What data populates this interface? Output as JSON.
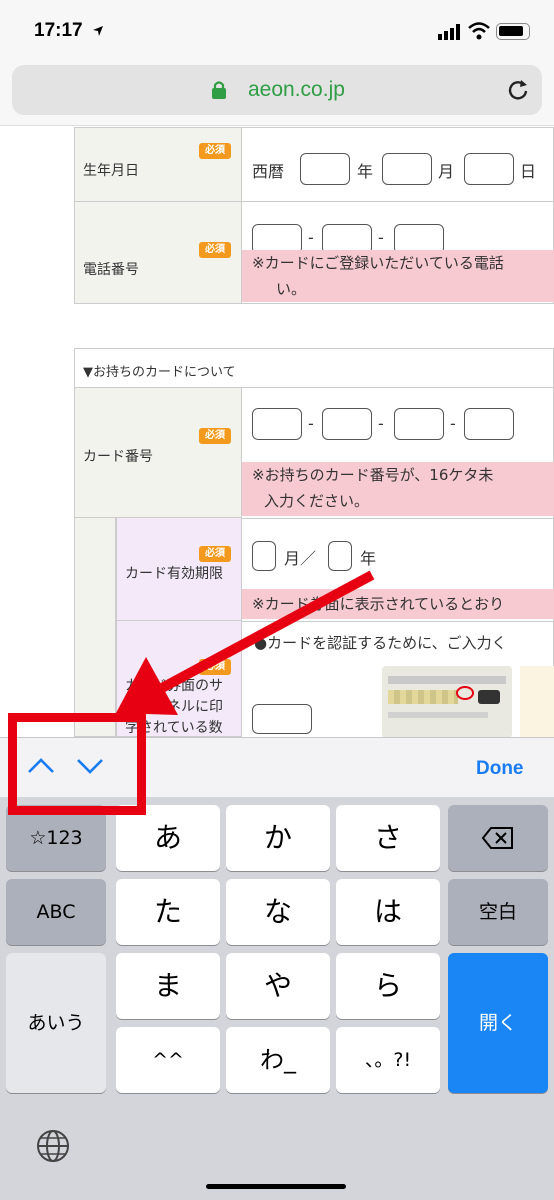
{
  "status": {
    "time": "17:17"
  },
  "browser": {
    "url": "aeon.co.jp"
  },
  "form": {
    "birthdate": {
      "label": "生年月日",
      "required": "必須",
      "era": "西暦",
      "year": "年",
      "month": "月",
      "day": "日"
    },
    "phone": {
      "label": "電話番号",
      "required": "必須",
      "sep": "-",
      "note_line1": "※カードにご登録いただいている電話",
      "note_line2": "い。"
    },
    "section_title": "▼お持ちのカードについて",
    "card_number": {
      "label": "カード番号",
      "required": "必須",
      "sep": "-",
      "note_line1": "※お持ちのカード番号が、16ケタ未",
      "note_line2": "入力ください。"
    },
    "expiry": {
      "label": "カード有効期限",
      "required": "必須",
      "month": "月／",
      "year": "年",
      "note": "※カード券面に表示されているとおり"
    },
    "security": {
      "label_line1": "カード券面のサ",
      "label_line2": "インパネルに印",
      "label_line3": "字されている数",
      "required": "必須",
      "note": "●カードを認証するために、ご入力く"
    }
  },
  "toolbar": {
    "done_label": "Done"
  },
  "keyboard": {
    "row1": [
      "☆123",
      "あ",
      "か",
      "さ"
    ],
    "row2": [
      "ABC",
      "た",
      "な",
      "は",
      "空白"
    ],
    "row3": [
      "ま",
      "や",
      "ら"
    ],
    "row4": [
      "^^",
      "わ_",
      "、。?!"
    ],
    "kana_mode": "あいう",
    "enter": "開く"
  },
  "colors": {
    "highlight": "#e60012",
    "arrow": "#e60012",
    "required_badge": "#f39a1e",
    "note_bg": "#f7c9d0",
    "enter_key": "#1a86f6",
    "toolbar_blue": "#1a7cf2"
  }
}
